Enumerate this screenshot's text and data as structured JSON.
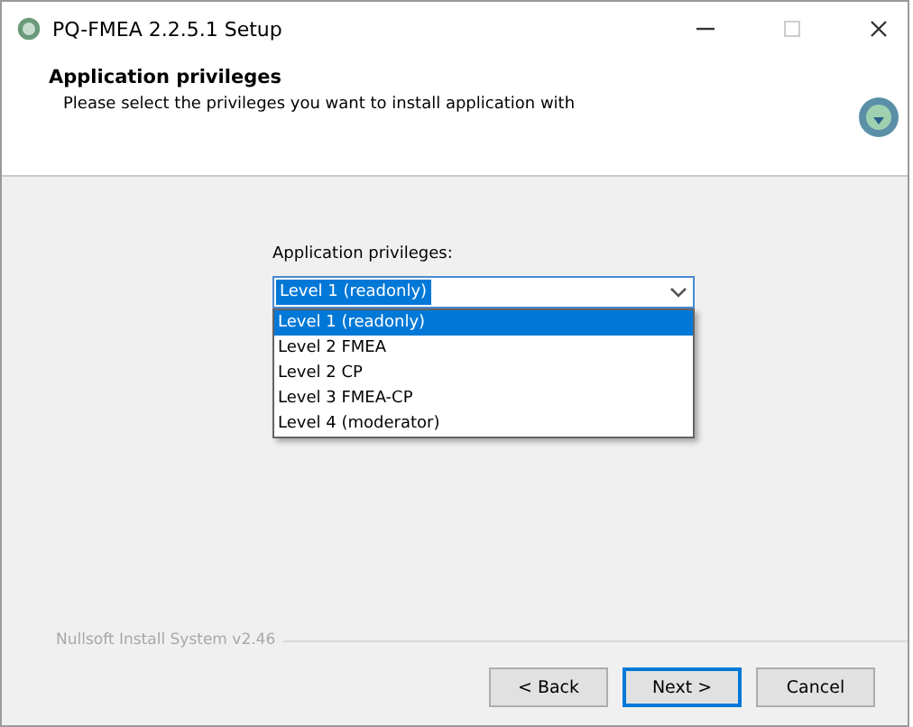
{
  "window": {
    "title": "PQ-FMEA 2.2.5.1 Setup"
  },
  "header": {
    "title": "Application privileges",
    "subtitle": "Please select the privileges you want to install application with"
  },
  "field_label": "Application privileges:",
  "dropdown": {
    "value": "Level 1 (readonly)",
    "expanded": true
  },
  "options": [
    {
      "label": "Level 1 (readonly)",
      "selected": true
    },
    {
      "label": "Level 2 FMEA",
      "selected": false
    },
    {
      "label": "Level 2 CP",
      "selected": false
    },
    {
      "label": "Level 3 FMEA-CP",
      "selected": false
    },
    {
      "label": "Level 4 (moderator)",
      "selected": false
    }
  ],
  "branding": "Nullsoft Install System v2.46",
  "buttons": [
    {
      "label": "< Back",
      "default": false
    },
    {
      "label": "Next >",
      "default": true
    },
    {
      "label": "Cancel",
      "default": false
    }
  ]
}
